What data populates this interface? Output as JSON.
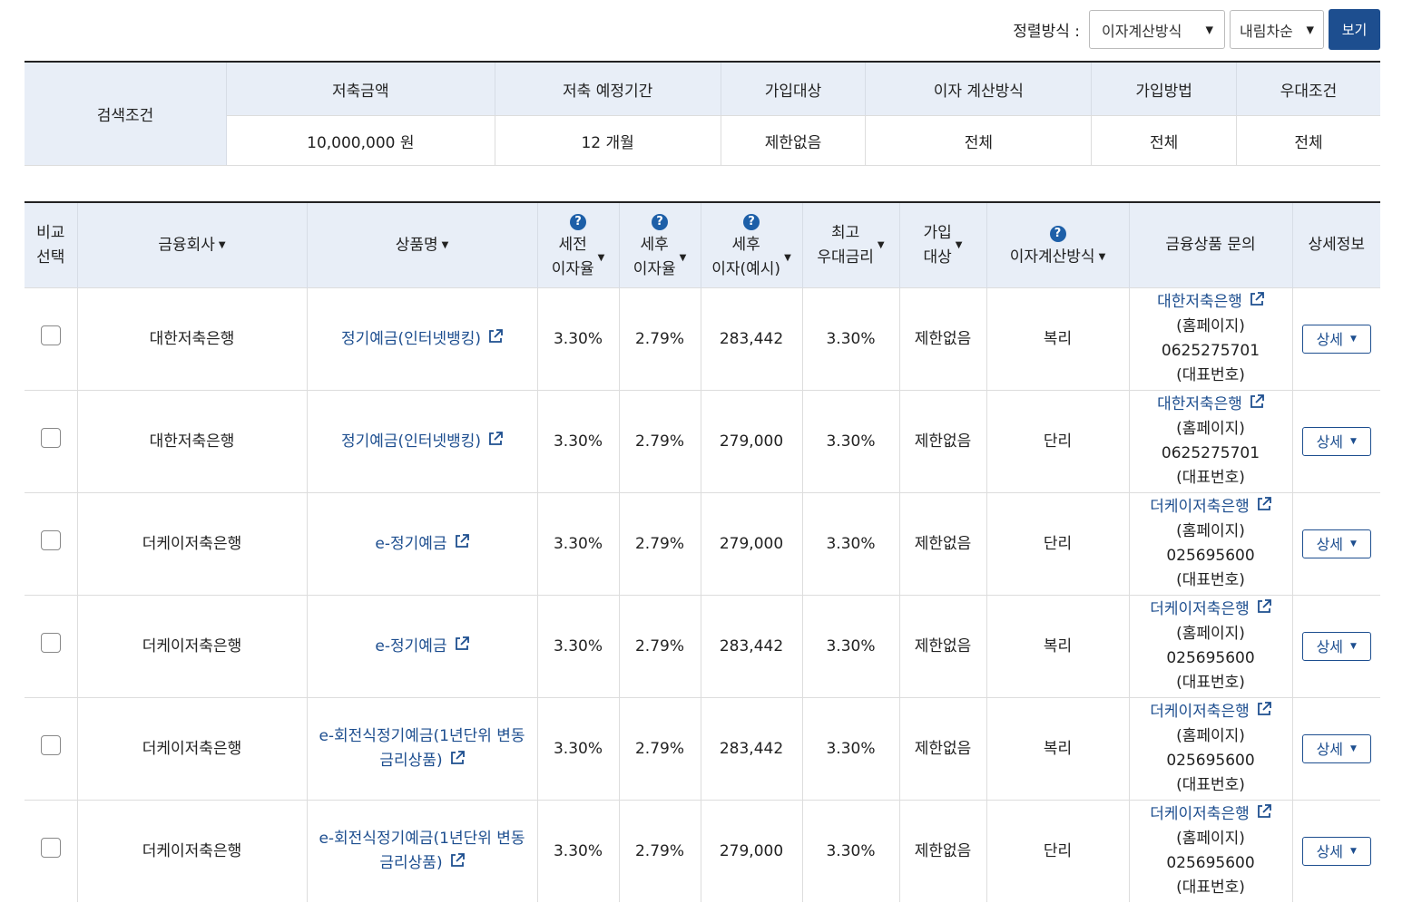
{
  "sort": {
    "label": "정렬방식 :",
    "method_value": "이자계산방식",
    "order_value": "내림차순",
    "view_button": "보기"
  },
  "conditions": {
    "label": "검색조건",
    "headers": [
      "저축금액",
      "저축 예정기간",
      "가입대상",
      "이자 계산방식",
      "가입방법",
      "우대조건"
    ],
    "values": [
      "10,000,000 원",
      "12 개월",
      "제한없음",
      "전체",
      "전체",
      "전체"
    ]
  },
  "table": {
    "headers": {
      "compare": [
        "비교",
        "선택"
      ],
      "company": "금융회사",
      "product": "상품명",
      "pretax": [
        "세전",
        "이자율"
      ],
      "posttax": [
        "세후",
        "이자율"
      ],
      "interest": [
        "세후",
        "이자(예시)"
      ],
      "maxrate": [
        "최고",
        "우대금리"
      ],
      "target": [
        "가입",
        "대상"
      ],
      "calc": "이자계산방식",
      "inquiry": "금융상품 문의",
      "detail": "상세정보"
    },
    "homepage_suffix": "(홈페이지)",
    "rep_suffix": "(대표번호)",
    "detail_label": "상세",
    "rows": [
      {
        "company": "대한저축은행",
        "product": [
          "정기예금(인터넷뱅킹)"
        ],
        "pretax": "3.30%",
        "posttax": "2.79%",
        "interest": "283,442",
        "maxrate": "3.30%",
        "target": "제한없음",
        "calc": "복리",
        "contact_name": "대한저축은행",
        "phone": "0625275701"
      },
      {
        "company": "대한저축은행",
        "product": [
          "정기예금(인터넷뱅킹)"
        ],
        "pretax": "3.30%",
        "posttax": "2.79%",
        "interest": "279,000",
        "maxrate": "3.30%",
        "target": "제한없음",
        "calc": "단리",
        "contact_name": "대한저축은행",
        "phone": "0625275701"
      },
      {
        "company": "더케이저축은행",
        "product": [
          "e-정기예금"
        ],
        "pretax": "3.30%",
        "posttax": "2.79%",
        "interest": "279,000",
        "maxrate": "3.30%",
        "target": "제한없음",
        "calc": "단리",
        "contact_name": "더케이저축은행",
        "phone": "025695600"
      },
      {
        "company": "더케이저축은행",
        "product": [
          "e-정기예금"
        ],
        "pretax": "3.30%",
        "posttax": "2.79%",
        "interest": "283,442",
        "maxrate": "3.30%",
        "target": "제한없음",
        "calc": "복리",
        "contact_name": "더케이저축은행",
        "phone": "025695600"
      },
      {
        "company": "더케이저축은행",
        "product": [
          "e-회전식정기예금(1년단위 변동",
          "금리상품)"
        ],
        "pretax": "3.30%",
        "posttax": "2.79%",
        "interest": "283,442",
        "maxrate": "3.30%",
        "target": "제한없음",
        "calc": "복리",
        "contact_name": "더케이저축은행",
        "phone": "025695600"
      },
      {
        "company": "더케이저축은행",
        "product": [
          "e-회전식정기예금(1년단위 변동",
          "금리상품)"
        ],
        "pretax": "3.30%",
        "posttax": "2.79%",
        "interest": "279,000",
        "maxrate": "3.30%",
        "target": "제한없음",
        "calc": "단리",
        "contact_name": "더케이저축은행",
        "phone": "025695600"
      }
    ]
  }
}
